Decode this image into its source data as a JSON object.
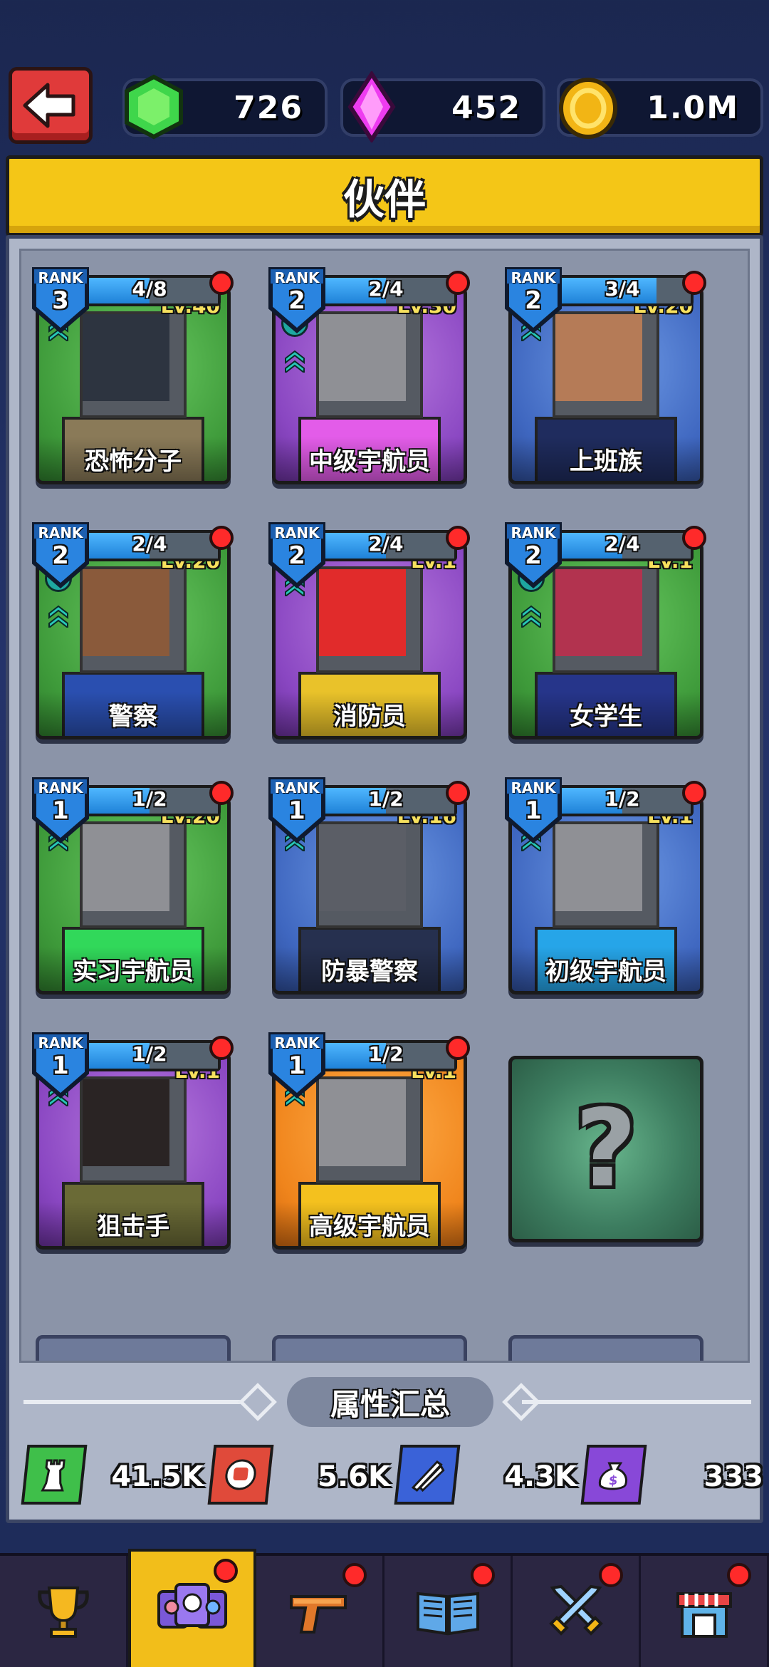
{
  "currency": {
    "gems": "726",
    "crystals": "452",
    "coins": "1.0M"
  },
  "header": {
    "title": "伙伴"
  },
  "partners": [
    {
      "name": "恐怖分子",
      "rank_label": "RANK",
      "rank": "3",
      "progress_text": "4/8",
      "progress": 0.5,
      "level": "Lv.40",
      "theme": "green",
      "plus": false,
      "body": "#8a7a58",
      "head": "#2d3440"
    },
    {
      "name": "中级宇航员",
      "rank_label": "RANK",
      "rank": "2",
      "progress_text": "2/4",
      "progress": 0.5,
      "level": "Lv.30",
      "theme": "purple",
      "plus": true,
      "body": "#e35ce9",
      "head": "#8f9095"
    },
    {
      "name": "上班族",
      "rank_label": "RANK",
      "rank": "2",
      "progress_text": "3/4",
      "progress": 0.75,
      "level": "Lv.20",
      "theme": "blue",
      "plus": false,
      "body": "#1f2c5e",
      "head": "#b57b57"
    },
    {
      "name": "警察",
      "rank_label": "RANK",
      "rank": "2",
      "progress_text": "2/4",
      "progress": 0.5,
      "level": "Lv.20",
      "theme": "green",
      "plus": true,
      "body": "#2a4fb0",
      "head": "#8a5a3b"
    },
    {
      "name": "消防员",
      "rank_label": "RANK",
      "rank": "2",
      "progress_text": "2/4",
      "progress": 0.5,
      "level": "Lv.1",
      "theme": "purple",
      "plus": false,
      "body": "#e9c22a",
      "head": "#e12b2b"
    },
    {
      "name": "女学生",
      "rank_label": "RANK",
      "rank": "2",
      "progress_text": "2/4",
      "progress": 0.5,
      "level": "Lv.1",
      "theme": "green",
      "plus": true,
      "body": "#26358a",
      "head": "#b2334f"
    },
    {
      "name": "实习宇航员",
      "rank_label": "RANK",
      "rank": "1",
      "progress_text": "1/2",
      "progress": 0.5,
      "level": "Lv.20",
      "theme": "green",
      "plus": false,
      "body": "#31d85a",
      "head": "#8f9095"
    },
    {
      "name": "防暴警察",
      "rank_label": "RANK",
      "rank": "1",
      "progress_text": "1/2",
      "progress": 0.5,
      "level": "Lv.16",
      "theme": "blue",
      "plus": false,
      "body": "#26304f",
      "head": "#5b5e66"
    },
    {
      "name": "初级宇航员",
      "rank_label": "RANK",
      "rank": "1",
      "progress_text": "1/2",
      "progress": 0.5,
      "level": "Lv.1",
      "theme": "blue",
      "plus": false,
      "body": "#26a5e8",
      "head": "#8f9095"
    },
    {
      "name": "狙击手",
      "rank_label": "RANK",
      "rank": "1",
      "progress_text": "1/2",
      "progress": 0.5,
      "level": "Lv.1",
      "theme": "purple",
      "plus": false,
      "body": "#6a6a36",
      "head": "#2a2424"
    },
    {
      "name": "高级宇航员",
      "rank_label": "RANK",
      "rank": "1",
      "progress_text": "1/2",
      "progress": 0.5,
      "level": "Lv.1",
      "theme": "orange",
      "plus": false,
      "body": "#f4c11e",
      "head": "#8f9095"
    }
  ],
  "mystery": {
    "symbol": "?"
  },
  "summary": {
    "title": "属性汇总",
    "stats": [
      {
        "icon": "tower-icon",
        "value": "41.5K",
        "color": "#3fbf4a"
      },
      {
        "icon": "fist-icon",
        "value": "5.6K",
        "color": "#e04a3a"
      },
      {
        "icon": "ammo-icon",
        "value": "4.3K",
        "color": "#3a62d8"
      },
      {
        "icon": "money-bag-icon",
        "value": "333",
        "color": "#8848d8"
      }
    ]
  },
  "nav": [
    {
      "icon": "trophy-icon",
      "active": false,
      "dot": false
    },
    {
      "icon": "partners-icon",
      "active": true,
      "dot": true
    },
    {
      "icon": "pistol-icon",
      "active": false,
      "dot": true
    },
    {
      "icon": "book-icon",
      "active": false,
      "dot": true
    },
    {
      "icon": "crossed-swords-icon",
      "active": false,
      "dot": true
    },
    {
      "icon": "shop-icon",
      "active": false,
      "dot": true
    }
  ]
}
